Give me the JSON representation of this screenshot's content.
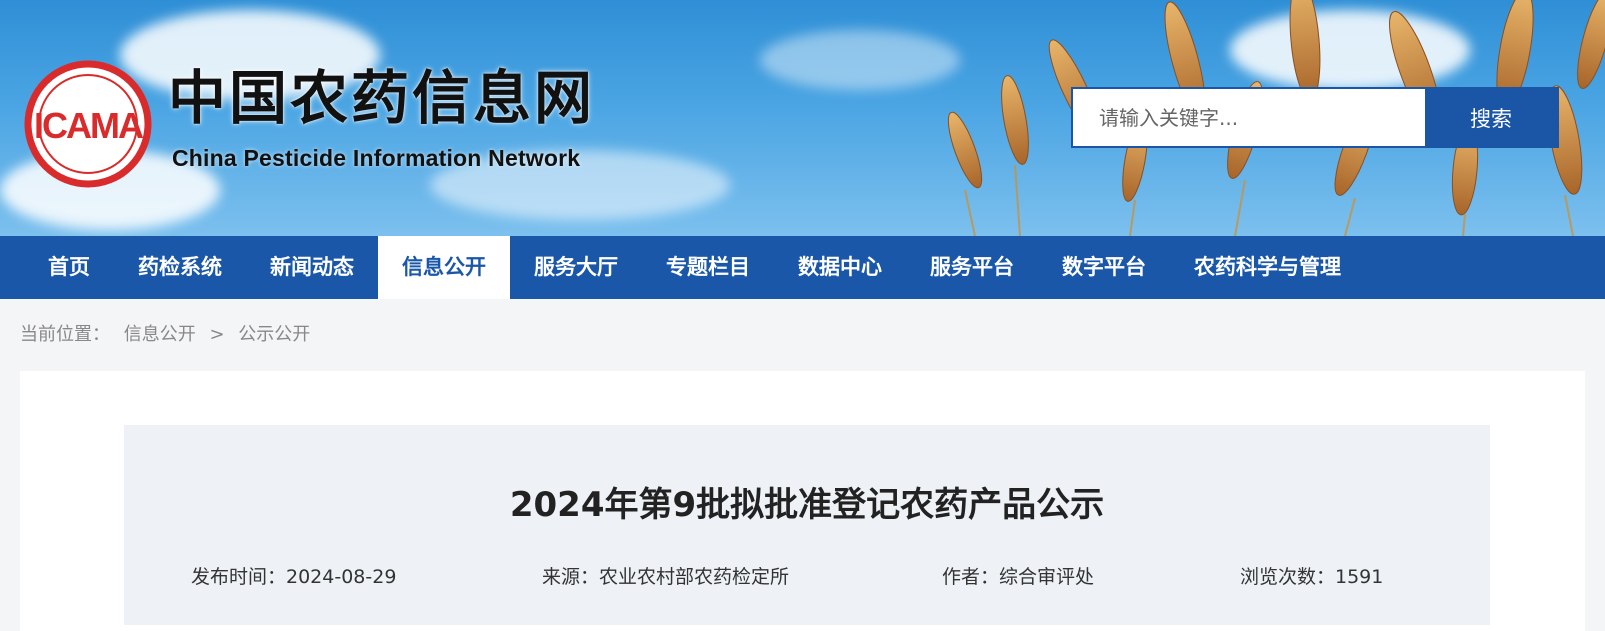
{
  "header": {
    "logo_text": "ICAMA",
    "title_cn": "中国农药信息网",
    "title_en": "China Pesticide Information Network",
    "search": {
      "placeholder": "请输入关键字...",
      "button_label": "搜索"
    }
  },
  "nav": {
    "items": [
      {
        "label": "首页"
      },
      {
        "label": "药检系统"
      },
      {
        "label": "新闻动态"
      },
      {
        "label": "信息公开",
        "active": true
      },
      {
        "label": "服务大厅"
      },
      {
        "label": "专题栏目"
      },
      {
        "label": "数据中心"
      },
      {
        "label": "服务平台"
      },
      {
        "label": "数字平台"
      },
      {
        "label": "农药科学与管理"
      }
    ]
  },
  "breadcrumb": {
    "prefix": "当前位置：",
    "items": [
      "信息公开",
      "公示公开"
    ],
    "separator": ">"
  },
  "article": {
    "title": "2024年第9批拟批准登记农药产品公示",
    "publish_time": "发布时间：2024-08-29",
    "source": "来源：农业农村部农药检定所",
    "author": "作者：综合审评处",
    "views": "浏览次数：1591"
  },
  "colors": {
    "primary": "#1a57a8",
    "logo_red": "#d92b2b",
    "page_bg": "#f4f5f7",
    "meta_bg": "#eef2f6"
  }
}
